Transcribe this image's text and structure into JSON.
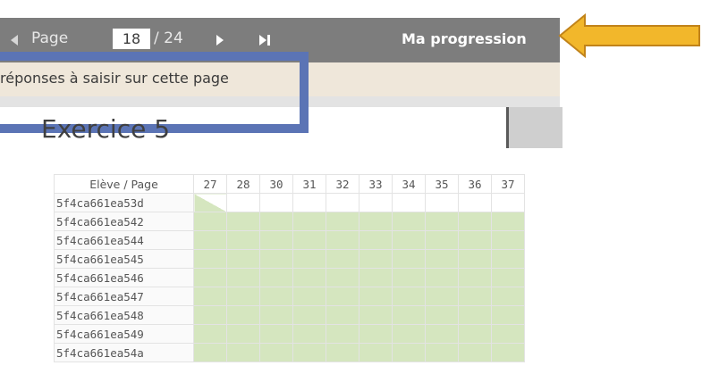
{
  "toolbar": {
    "page_label": "Page",
    "page_value": "18",
    "page_total": "/ 24",
    "progress_label": "Ma progression"
  },
  "infobar": {
    "text": "réponses à saisir sur cette page"
  },
  "exercise": {
    "title": "Exercice 5"
  },
  "grid": {
    "corner_label": "Elève / Page",
    "pages": [
      "27",
      "28",
      "30",
      "31",
      "32",
      "33",
      "34",
      "35",
      "36",
      "37"
    ],
    "students": [
      "5f4ca661ea53d",
      "5f4ca661ea542",
      "5f4ca661ea544",
      "5f4ca661ea545",
      "5f4ca661ea546",
      "5f4ca661ea547",
      "5f4ca661ea548",
      "5f4ca661ea549",
      "5f4ca661ea54a"
    ]
  },
  "colors": {
    "toolbar_bg": "#7d7d7d",
    "highlight_border": "#5b74b5",
    "arrow_fill": "#f2b72b",
    "cell_done": "#d5e6bf"
  },
  "icons": [
    "previous-page-icon",
    "next-page-icon",
    "last-page-icon",
    "pointer-arrow-icon"
  ]
}
